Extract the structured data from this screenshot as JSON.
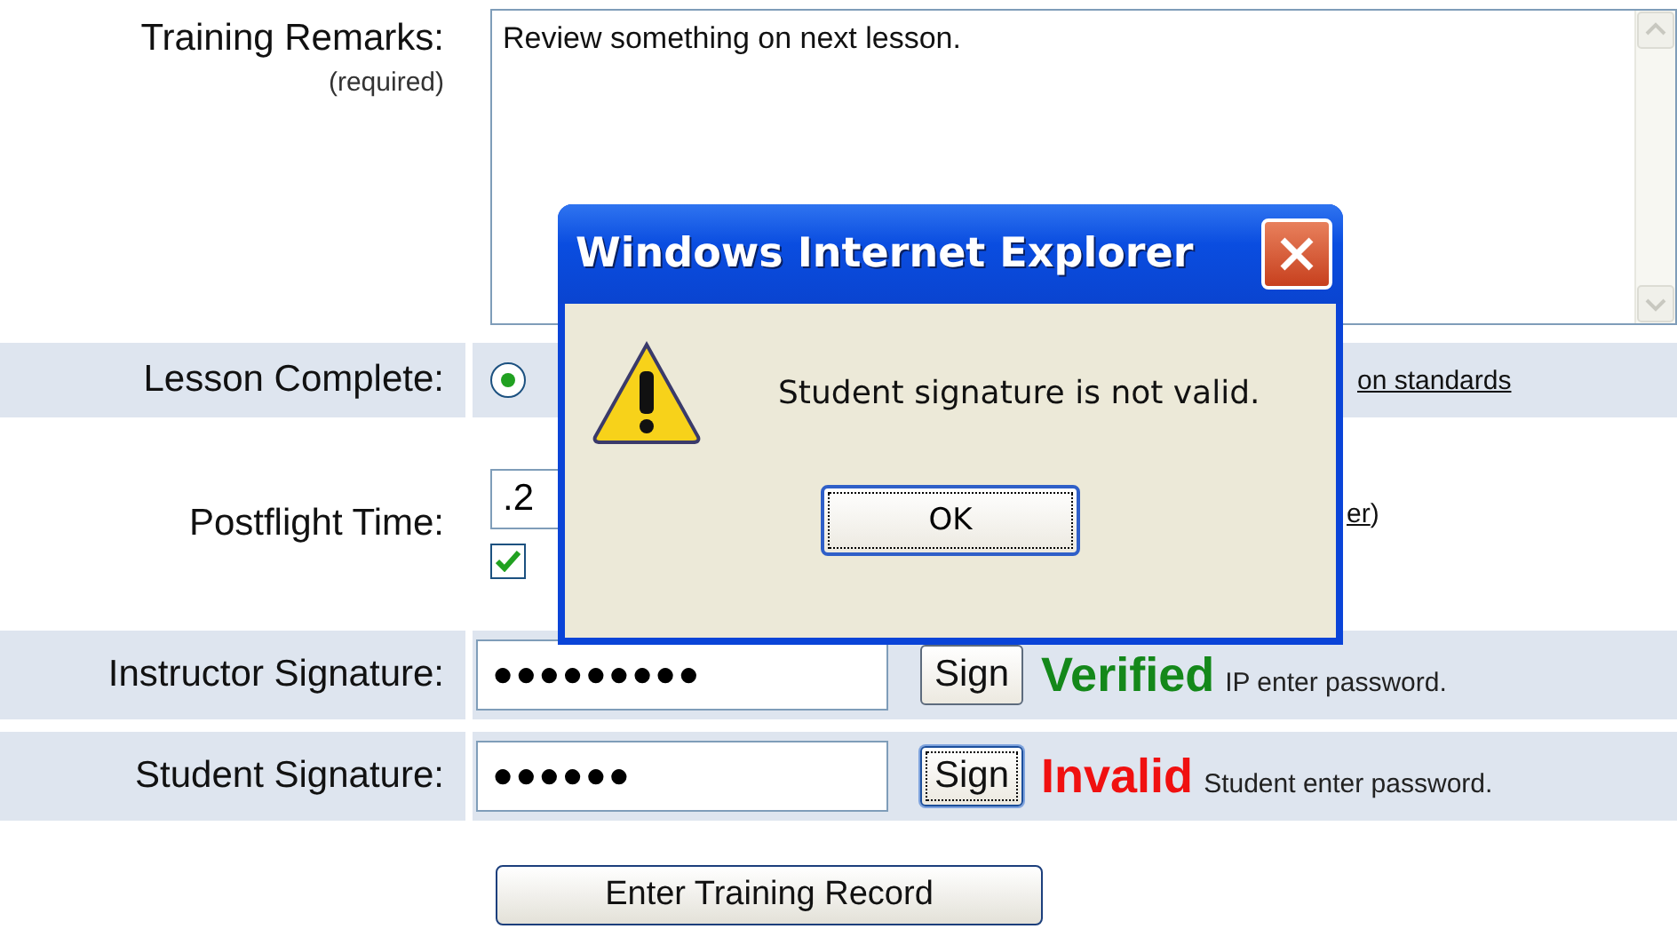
{
  "remarks": {
    "label": "Training Remarks:",
    "note": "(required)",
    "value": "Review something on next lesson."
  },
  "lesson_complete": {
    "label": "Lesson Complete:",
    "radio": {
      "selected": true
    },
    "link": "on standards"
  },
  "postflight": {
    "label": "Postflight Time:",
    "value": ".2",
    "checked": true,
    "link": "er",
    "suffix": ")"
  },
  "signatures": [
    {
      "label": "Instructor Signature:",
      "value": "●●●●●●●●●",
      "button": "Sign",
      "focused": false,
      "status": "Verified",
      "valid": true,
      "hint": "IP enter password."
    },
    {
      "label": "Student Signature:",
      "value": "●●●●●●",
      "button": "Sign",
      "focused": true,
      "status": "Invalid",
      "valid": false,
      "hint": "Student enter password."
    }
  ],
  "submit": "Enter Training Record",
  "dialog": {
    "title": "Windows Internet Explorer",
    "message": "Student signature is not valid.",
    "button": "OK"
  }
}
